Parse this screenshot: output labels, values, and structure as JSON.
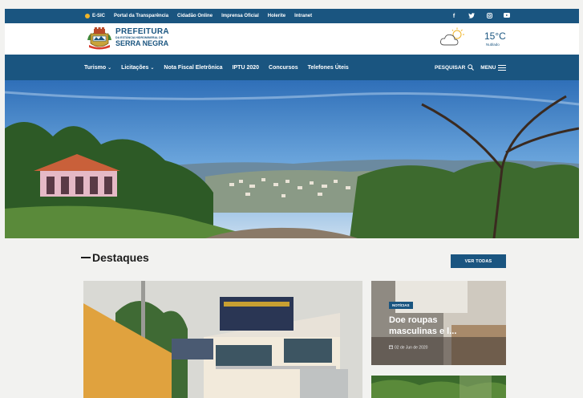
{
  "topbar": {
    "links": [
      "E-SIC",
      "Portal da Transparência",
      "Cidadão Online",
      "Imprensa Oficial",
      "Holerite",
      "Intranet"
    ],
    "social_icons": [
      "facebook-icon",
      "twitter-icon",
      "instagram-icon",
      "youtube-icon"
    ],
    "social_glyphs": [
      "f",
      "✦",
      "◎",
      "▶"
    ]
  },
  "header": {
    "logo_line1": "PREFEITURA",
    "logo_line2": "DA ESTÂNCIA HIDROMINERAL DE",
    "logo_line3": "SERRA NEGRA",
    "weather_temp": "15°C",
    "weather_cond": "Nublado"
  },
  "nav": {
    "items": [
      {
        "label": "Turismo",
        "chevron": "⌄"
      },
      {
        "label": "Licitações",
        "chevron": "⌄"
      },
      {
        "label": "Nota Fiscal Eletrônica",
        "chevron": ""
      },
      {
        "label": "IPTU 2020",
        "chevron": ""
      },
      {
        "label": "Concursos",
        "chevron": ""
      },
      {
        "label": "Telefones Úteis",
        "chevron": ""
      }
    ],
    "search_label": "PESQUISAR",
    "menu_label": "MENU"
  },
  "destaques": {
    "title": "Destaques",
    "ver_todas": "VER TODAS",
    "side_card": {
      "badge": "NOTÍCIAS",
      "title": "Doe roupas masculinas e l...",
      "date": "02 de Jun de 2020"
    }
  },
  "colors": {
    "brand": "#1a5580",
    "accent": "#f0b428",
    "background": "#f2f2f0"
  }
}
